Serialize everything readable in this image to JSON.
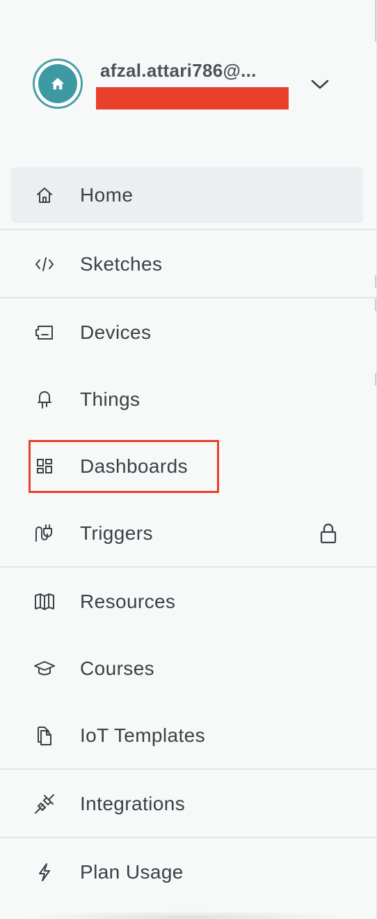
{
  "account": {
    "email": "afzal.attari786@...",
    "avatar_icon": "home-icon",
    "menu_icon": "chevron-down-icon",
    "avatar_color": "#3d9aa3",
    "redaction_color": "#e8402b"
  },
  "nav": {
    "home": {
      "label": "Home",
      "icon": "home-icon"
    },
    "sketches": {
      "label": "Sketches",
      "icon": "code-icon"
    },
    "devices": {
      "label": "Devices",
      "icon": "device-icon"
    },
    "things": {
      "label": "Things",
      "icon": "thing-icon"
    },
    "dashboards": {
      "label": "Dashboards",
      "icon": "dashboard-icon"
    },
    "triggers": {
      "label": "Triggers",
      "icon": "trigger-icon",
      "badge_icon": "lock-icon"
    },
    "resources": {
      "label": "Resources",
      "icon": "book-icon"
    },
    "courses": {
      "label": "Courses",
      "icon": "graduation-cap-icon"
    },
    "iot_templates": {
      "label": "IoT Templates",
      "icon": "documents-icon"
    },
    "integrations": {
      "label": "Integrations",
      "icon": "plug-icon"
    },
    "plan_usage": {
      "label": "Plan Usage",
      "icon": "lightning-icon"
    }
  },
  "active_item": "Home",
  "highlighted_item": "Dashboards",
  "highlight_color": "#e8402b"
}
